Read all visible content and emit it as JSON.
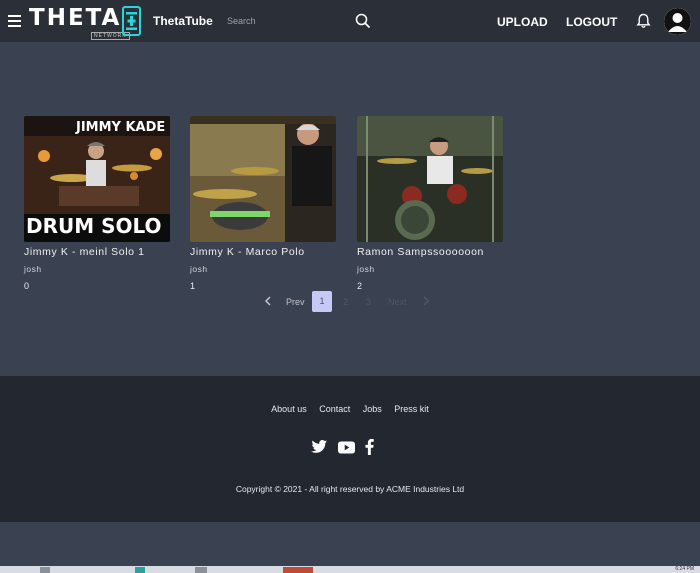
{
  "header": {
    "logo_text": "THETA",
    "logo_sub": "NETWORK",
    "brand": "ThetaTube",
    "search_placeholder": "Search",
    "upload_label": "UPLOAD",
    "logout_label": "LOGOUT"
  },
  "videos": [
    {
      "title": "Jimmy K - meinl Solo 1",
      "user": "josh",
      "count": "0",
      "overlay_top": "JIMMY KADE",
      "overlay_bottom": "DRUM SOLO"
    },
    {
      "title": "Jimmy K - Marco Polo",
      "user": "josh",
      "count": "1"
    },
    {
      "title": "Ramon Sampssoooooon",
      "user": "josh",
      "count": "2"
    }
  ],
  "pagination": {
    "prev": "Prev",
    "current": "1",
    "page2": "2",
    "page3": "3",
    "next": "Next"
  },
  "footer": {
    "links": [
      "About us",
      "Contact",
      "Jobs",
      "Press kit"
    ],
    "copyright": "Copyright © 2021 - All right reserved by ACME Industries Ltd"
  },
  "taskbar": {
    "clock": "6:24 PM"
  },
  "colors": {
    "header_bg": "#2b2f37",
    "page_bg": "#3a4150",
    "footer_bg": "#23272f",
    "accent": "#26d6d8",
    "pager_active": "#c6c9f3"
  },
  "icons": [
    "hamburger-icon",
    "search-icon",
    "bell-icon",
    "avatar-icon",
    "twitter-icon",
    "youtube-icon",
    "facebook-icon",
    "chevron-left-icon",
    "chevron-right-icon"
  ]
}
